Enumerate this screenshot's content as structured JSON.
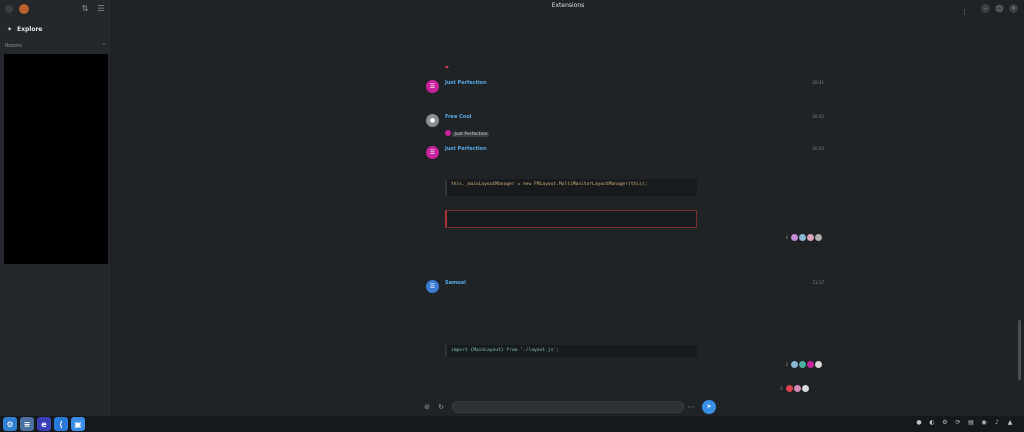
{
  "window": {
    "title": "Extensions",
    "subtitle": ""
  },
  "sidebar": {
    "explore_label": "Explore",
    "section_label": "Rooms"
  },
  "messages": [
    {
      "id": "m0",
      "name": "",
      "time": "",
      "lines": [],
      "hearts_line": ""
    },
    {
      "id": "m1",
      "name": "Just Perfection",
      "time": "20:41",
      "avatar_letter": "JP",
      "lines": [],
      "avatar_color": "#c8229c"
    },
    {
      "id": "m2",
      "name": "Free Cool",
      "time": "20:42",
      "avatar_letter": "FC",
      "avatar_color": "#8a8f93",
      "lines": [],
      "reply_name": "Just Perfection"
    },
    {
      "id": "m3",
      "name": "Just Perfection",
      "time": "20:43",
      "avatar_letter": "JP",
      "avatar_color": "#c8229c",
      "lines": [],
      "code1": "this._mainLayoutManager = new FMLayout.MultiMonitorLayoutManager(this);",
      "code2": ""
    },
    {
      "id": "m4",
      "name": "Samuel",
      "time": "11:17",
      "avatar_letter": "S",
      "avatar_color": "#3a7bd5",
      "lines": [],
      "link": "",
      "code": "import {MainLayout} from './layout.js';"
    }
  ],
  "date_divider": "",
  "notes": {
    "above_samuel": "",
    "below_samuel": ""
  },
  "composer": {
    "placeholder": ""
  },
  "reactions": [
    {
      "count": "4",
      "colors": [
        "#c78ad8",
        "#8ab8d8",
        "#e0a4c0",
        "#b0b0b0"
      ]
    },
    {
      "count": "3",
      "colors": [
        "#8ab8d8",
        "#4fb0a0",
        "#c8229c",
        "#d8d8d8"
      ]
    },
    {
      "count": "3",
      "colors": [
        "#e0414f",
        "#d88ab8",
        "#d8d8d8"
      ]
    }
  ],
  "taskbar": {
    "apps": [
      {
        "name": "app-1",
        "color": "#2f7fd0",
        "glyph": "⚙"
      },
      {
        "name": "app-2",
        "color": "#4b6f9e",
        "glyph": "≡"
      },
      {
        "name": "app-3",
        "color": "#3b3fb8",
        "glyph": "e"
      },
      {
        "name": "app-4",
        "color": "#2a7ad8",
        "glyph": "⟨"
      },
      {
        "name": "app-5",
        "color": "#3a8ee6",
        "glyph": "▣"
      }
    ]
  }
}
